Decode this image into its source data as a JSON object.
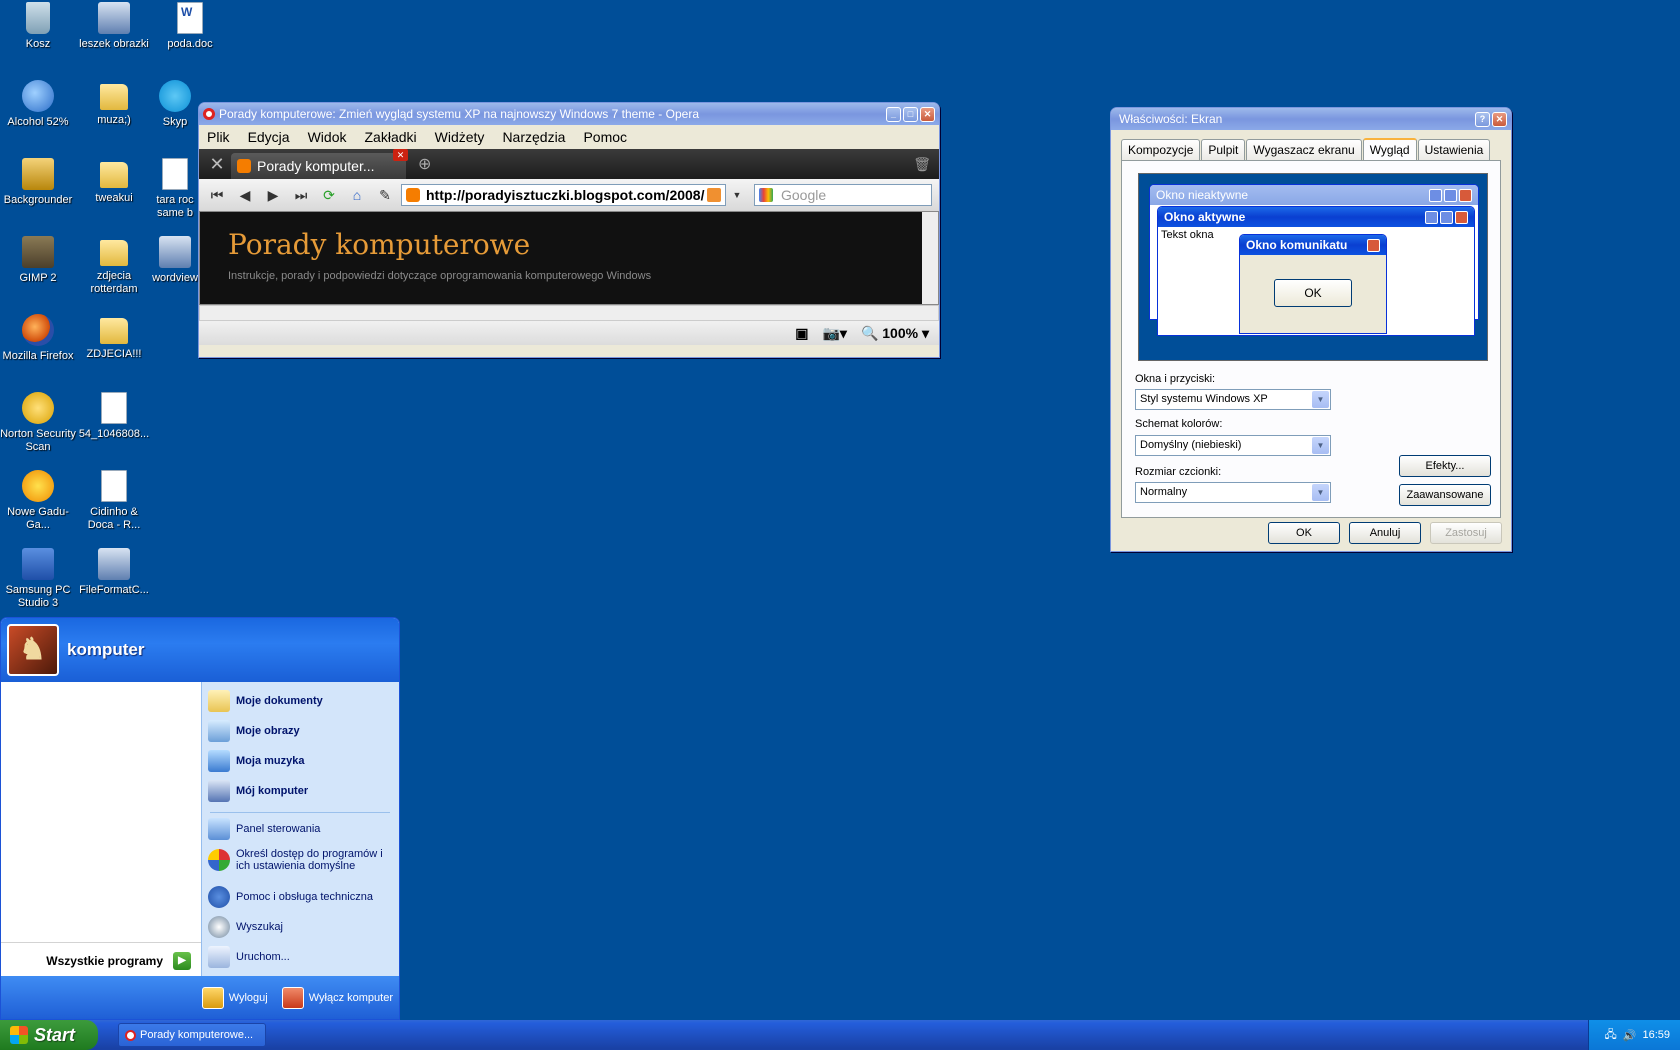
{
  "desktop": {
    "icons": [
      {
        "label": "Kosz",
        "icon": "recycle-bin-icon"
      },
      {
        "label": "leszek obrazki",
        "icon": "computer-icon"
      },
      {
        "label": "poda.doc",
        "icon": "word-document-icon"
      },
      {
        "label": "Alcohol 52%",
        "icon": "alcohol-icon"
      },
      {
        "label": "muza;)",
        "icon": "folder-icon"
      },
      {
        "label": "Skyp",
        "icon": "skype-icon"
      },
      {
        "label": "Backgrounder",
        "icon": "backgrounder-icon"
      },
      {
        "label": "tweakui",
        "icon": "folder-icon"
      },
      {
        "label": "tara roc same b",
        "icon": "shortcut-icon"
      },
      {
        "label": "GIMP 2",
        "icon": "gimp-icon"
      },
      {
        "label": "zdjecia rotterdam",
        "icon": "folder-icon"
      },
      {
        "label": "wordview",
        "icon": "wordview-icon"
      },
      {
        "label": "Mozilla Firefox",
        "icon": "firefox-icon"
      },
      {
        "label": "ZDJECIA!!!",
        "icon": "folder-icon"
      },
      {
        "label": "Norton Security Scan",
        "icon": "norton-icon"
      },
      {
        "label": "54_1046808...",
        "icon": "file-icon"
      },
      {
        "label": "Nowe Gadu-Ga...",
        "icon": "gadu-gadu-icon"
      },
      {
        "label": "Cidinho & Doca - R...",
        "icon": "audio-file-icon"
      },
      {
        "label": "Samsung PC Studio 3",
        "icon": "samsung-icon"
      },
      {
        "label": "FileFormatC...",
        "icon": "fileformat-icon"
      }
    ]
  },
  "opera": {
    "title": "Porady komputerowe: Zmień wygląd systemu XP na najnowszy Windows 7 theme - Opera",
    "menu": [
      "Plik",
      "Edycja",
      "Widok",
      "Zakładki",
      "Widżety",
      "Narzędzia",
      "Pomoc"
    ],
    "tab_label": "Porady komputer...",
    "address": "http://poradyisztuczki.blogspot.com/2008/",
    "search_placeholder": "Google",
    "page_heading": "Porady komputerowe",
    "page_sub": "Instrukcje, porady i podpowiedzi dotyczące oprogramowania komputerowego Windows",
    "zoom": "100%"
  },
  "display": {
    "title": "Właściwości: Ekran",
    "tabs": [
      "Kompozycje",
      "Pulpit",
      "Wygaszacz ekranu",
      "Wygląd",
      "Ustawienia"
    ],
    "preview": {
      "inactive": "Okno nieaktywne",
      "active": "Okno aktywne",
      "text": "Tekst okna",
      "message": "Okno komunikatu",
      "ok": "OK"
    },
    "windows_label": "Okna i przyciski:",
    "windows_value": "Styl systemu Windows XP",
    "scheme_label": "Schemat kolorów:",
    "scheme_value": "Domyślny (niebieski)",
    "font_label": "Rozmiar czcionki:",
    "font_value": "Normalny",
    "effects": "Efekty...",
    "advanced": "Zaawansowane",
    "ok": "OK",
    "cancel": "Anuluj",
    "apply": "Zastosuj"
  },
  "startmenu": {
    "user": "komputer",
    "all_programs": "Wszystkie programy",
    "items_bold": [
      "Moje dokumenty",
      "Moje obrazy",
      "Moja muzyka",
      "Mój komputer"
    ],
    "items": [
      "Panel sterowania",
      "Określ dostęp do programów i ich ustawienia domyślne",
      "Pomoc i obsługa techniczna",
      "Wyszukaj",
      "Uruchom..."
    ],
    "logoff": "Wyloguj",
    "shutdown": "Wyłącz komputer"
  },
  "taskbar": {
    "start": "Start",
    "task": "Porady komputerowe...",
    "clock": "16:59"
  }
}
